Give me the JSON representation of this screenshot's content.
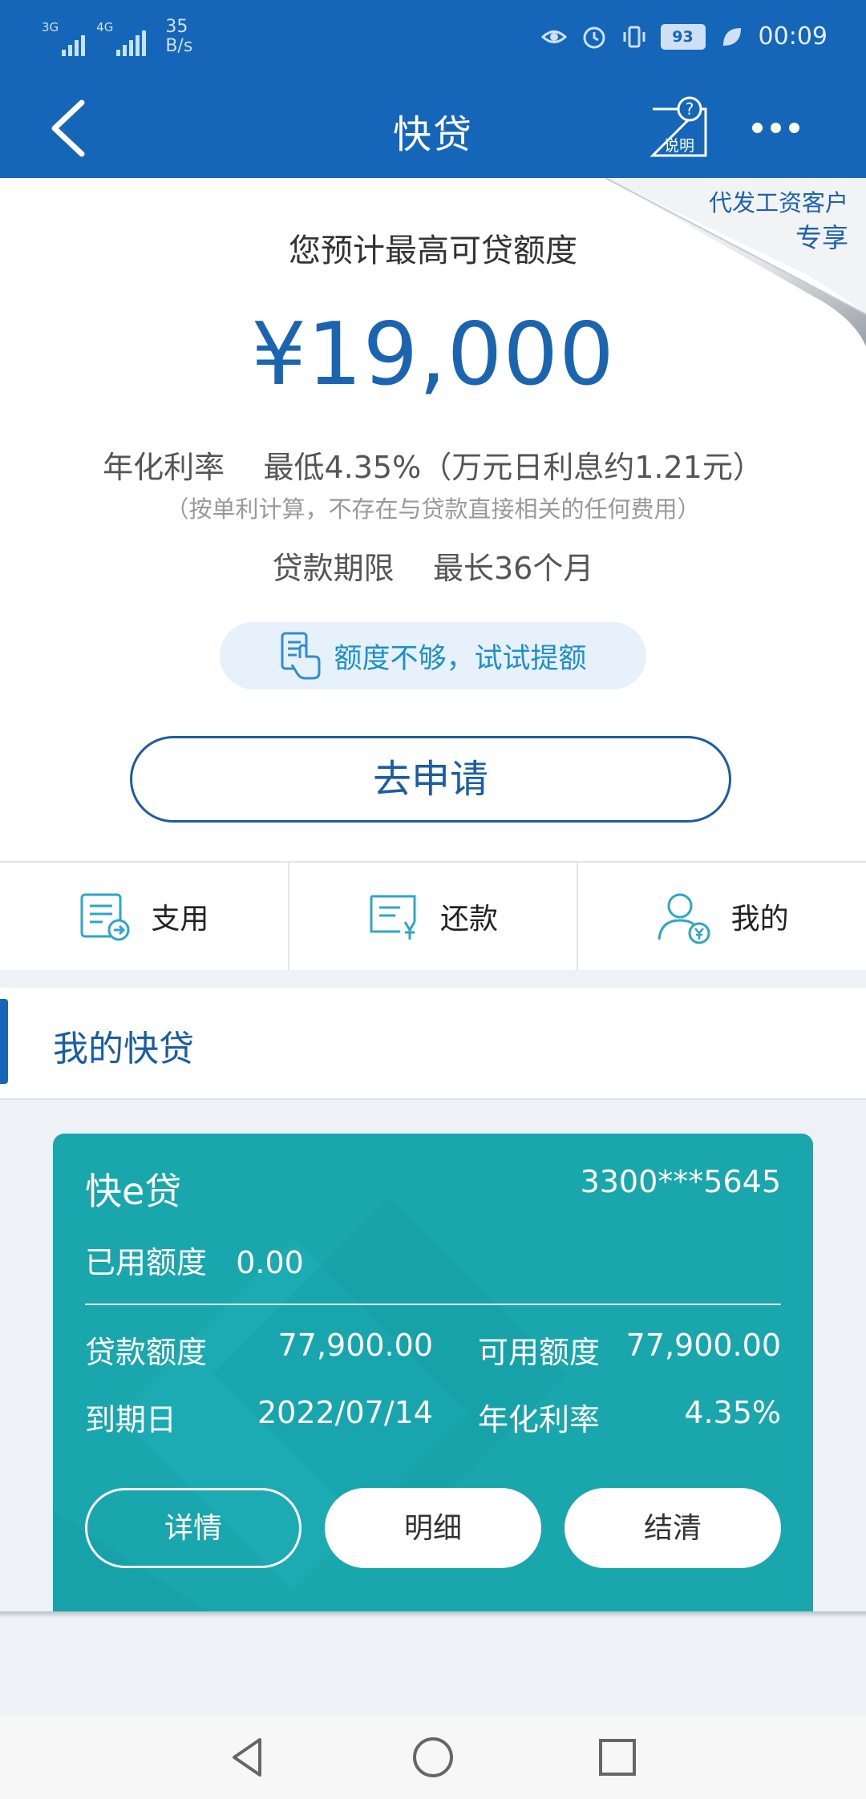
{
  "status_bar": {
    "network_1": "3G",
    "network_2": "4G",
    "speed_value": "35",
    "speed_unit": "B/s",
    "battery": "93",
    "time": "00:09"
  },
  "header": {
    "title": "快贷",
    "help_label": "说明"
  },
  "quota": {
    "ribbon_line1": "代发工资客户",
    "ribbon_line2": "专享",
    "caption": "您预计最高可贷额度",
    "amount": "¥19,000",
    "rate_line": "年化利率    最低4.35%（万元日利息约1.21元）",
    "rate_note": "（按单利计算，不存在与贷款直接相关的任何费用）",
    "term_line": "贷款期限    最长36个月",
    "raise_label": "额度不够，试试提额",
    "apply_label": "去申请"
  },
  "tabs": [
    {
      "label": "支用",
      "icon": "withdraw-doc-icon"
    },
    {
      "label": "还款",
      "icon": "repay-yen-icon"
    },
    {
      "label": "我的",
      "icon": "user-yen-icon"
    }
  ],
  "my_loan": {
    "title": "我的快贷"
  },
  "card": {
    "name": "快e贷",
    "account": "3300***5645",
    "used_line": "已用额度   0.00",
    "loan_amount_label": "贷款额度",
    "loan_amount": "77,900.00",
    "available_label": "可用额度",
    "available": "77,900.00",
    "due_label": "到期日",
    "due_date": "2022/07/14",
    "rate_label": "年化利率",
    "rate": "4.35%",
    "buttons": {
      "details": "详情",
      "statement": "明细",
      "settle": "结清"
    }
  },
  "colors": {
    "brand_blue": "#1565b8",
    "card_teal": "#1aa6ad"
  }
}
